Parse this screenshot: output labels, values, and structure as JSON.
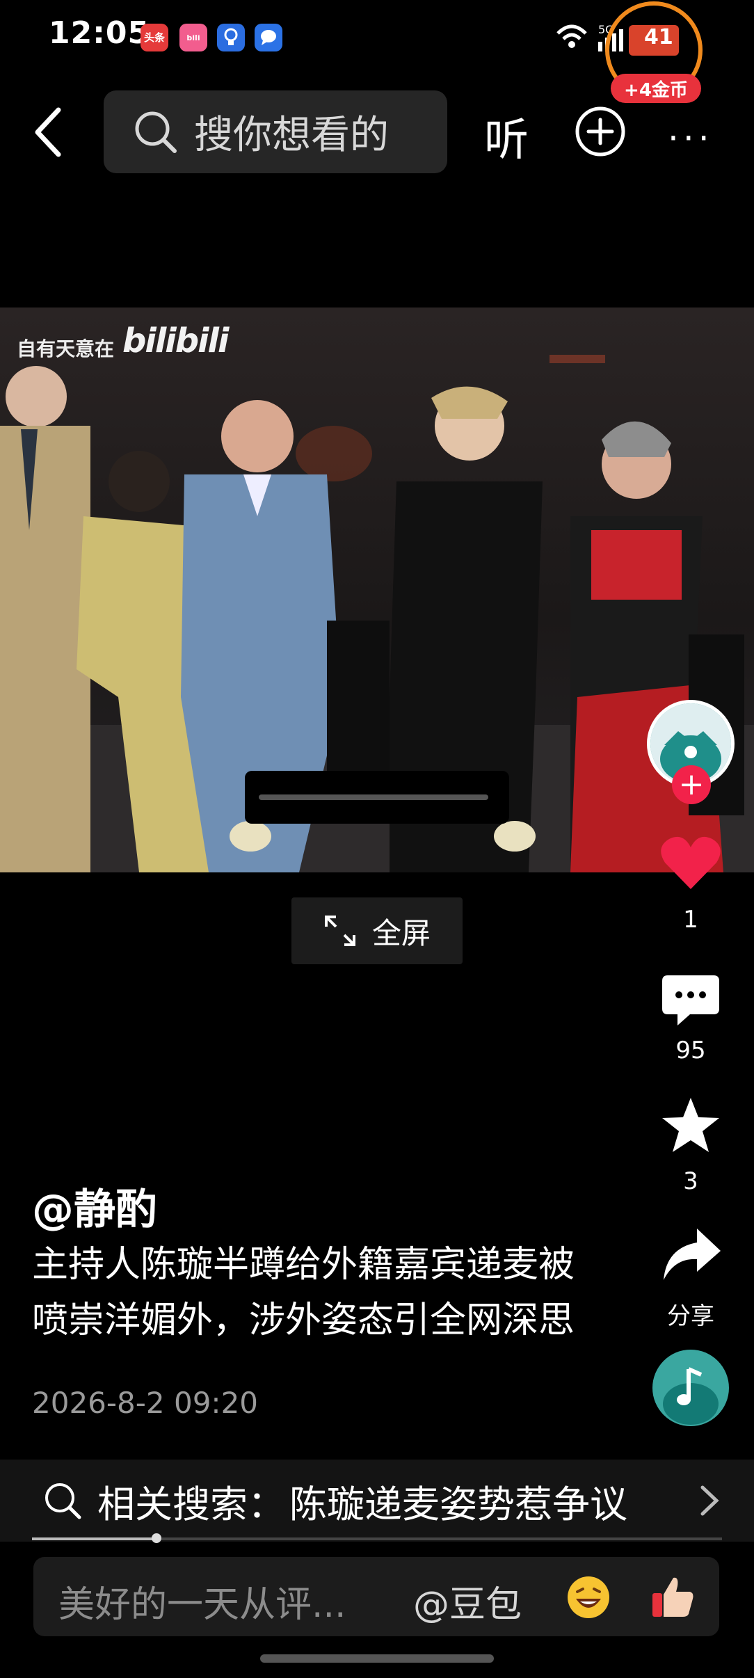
{
  "status_bar": {
    "time": "12:05",
    "apps": [
      "头条",
      "bili",
      "idea",
      "msg"
    ],
    "battery_level": "41"
  },
  "reward": {
    "label": "+4金币"
  },
  "top_bar": {
    "search_placeholder": "搜你想看的",
    "listen_label": "听",
    "more_label": "···"
  },
  "video": {
    "watermark_text": "自有天意在",
    "watermark_logo": "bilibili",
    "fullscreen_label": "全屏"
  },
  "actions": {
    "like_count": "1",
    "comment_count": "95",
    "favorite_count": "3",
    "share_label": "分享"
  },
  "post": {
    "author": "@静酌",
    "title": "主持人陈璇半蹲给外籍嘉宾递麦被喷崇洋媚外，涉外姿态引全网深思",
    "date": "2026-8-2 09:20"
  },
  "related_search": {
    "prefix": "相关搜索：",
    "query": "陈璇递麦姿势惹争议",
    "progress": 0.18
  },
  "comment_bar": {
    "placeholder": "美好的一天从评...",
    "mention": "@豆包"
  },
  "colors": {
    "like": "#f2224a",
    "reward_ring": "#f08a1d",
    "avatar": "#3aa7a0"
  }
}
